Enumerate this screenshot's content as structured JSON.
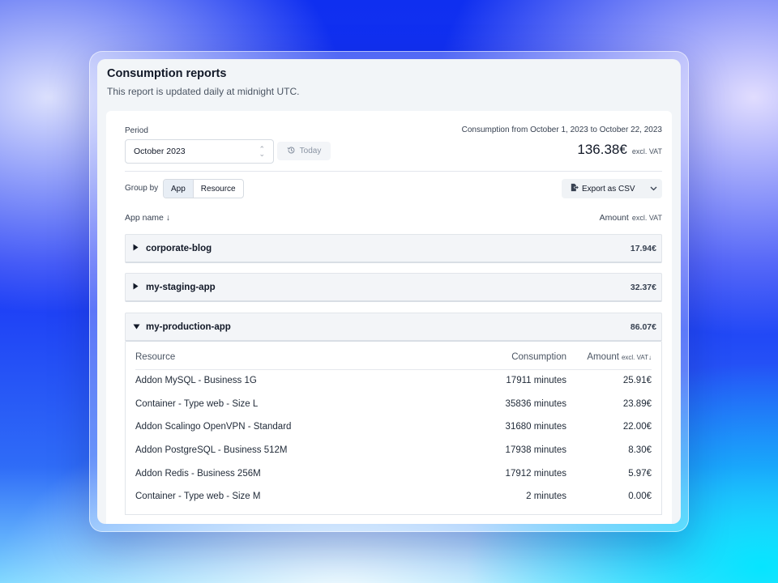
{
  "report": {
    "title": "Consumption reports",
    "subtitle": "This report is updated daily at midnight UTC."
  },
  "filters": {
    "period_label": "Period",
    "period_value": "October 2023",
    "today_label": "Today",
    "range_text": "Consumption from October 1, 2023 to October 22, 2023",
    "total_amount": "136.38€",
    "total_vat": "excl. VAT",
    "groupby_label": "Group by",
    "groupby_options": [
      "App",
      "Resource"
    ],
    "groupby_selected": "App",
    "export_label": "Export as CSV"
  },
  "table": {
    "col_app": "App name ↓",
    "col_amount": "Amount",
    "col_amount_vat": "excl. VAT",
    "apps": [
      {
        "name": "corporate-blog",
        "amount": "17.94€",
        "expanded": false
      },
      {
        "name": "my-staging-app",
        "amount": "32.37€",
        "expanded": false
      },
      {
        "name": "my-production-app",
        "amount": "86.07€",
        "expanded": true
      }
    ]
  },
  "detail": {
    "col_resource": "Resource",
    "col_consumption": "Consumption",
    "col_amount": "Amount",
    "col_amount_vat": "excl. VAT↓",
    "rows": [
      {
        "resource": "Addon MySQL - Business 1G",
        "consumption": "17911 minutes",
        "amount": "25.91€"
      },
      {
        "resource": "Container - Type web - Size L",
        "consumption": "35836 minutes",
        "amount": "23.89€"
      },
      {
        "resource": "Addon Scalingo OpenVPN - Standard",
        "consumption": "31680 minutes",
        "amount": "22.00€"
      },
      {
        "resource": "Addon PostgreSQL - Business 512M",
        "consumption": "17938 minutes",
        "amount": "8.30€"
      },
      {
        "resource": "Addon Redis - Business 256M",
        "consumption": "17912 minutes",
        "amount": "5.97€"
      },
      {
        "resource": "Container - Type web - Size M",
        "consumption": "2 minutes",
        "amount": "0.00€"
      }
    ]
  },
  "icons": {
    "select": "updown-chevron-icon",
    "today": "history-icon",
    "export": "file-export-icon",
    "export_caret": "chevron-down-icon",
    "collapsed": "caret-right-icon",
    "expanded": "caret-down-icon"
  },
  "colors": {
    "panel_bg": "#f2f5f8",
    "row_bg": "#f3f5f8",
    "text": "#111827"
  }
}
